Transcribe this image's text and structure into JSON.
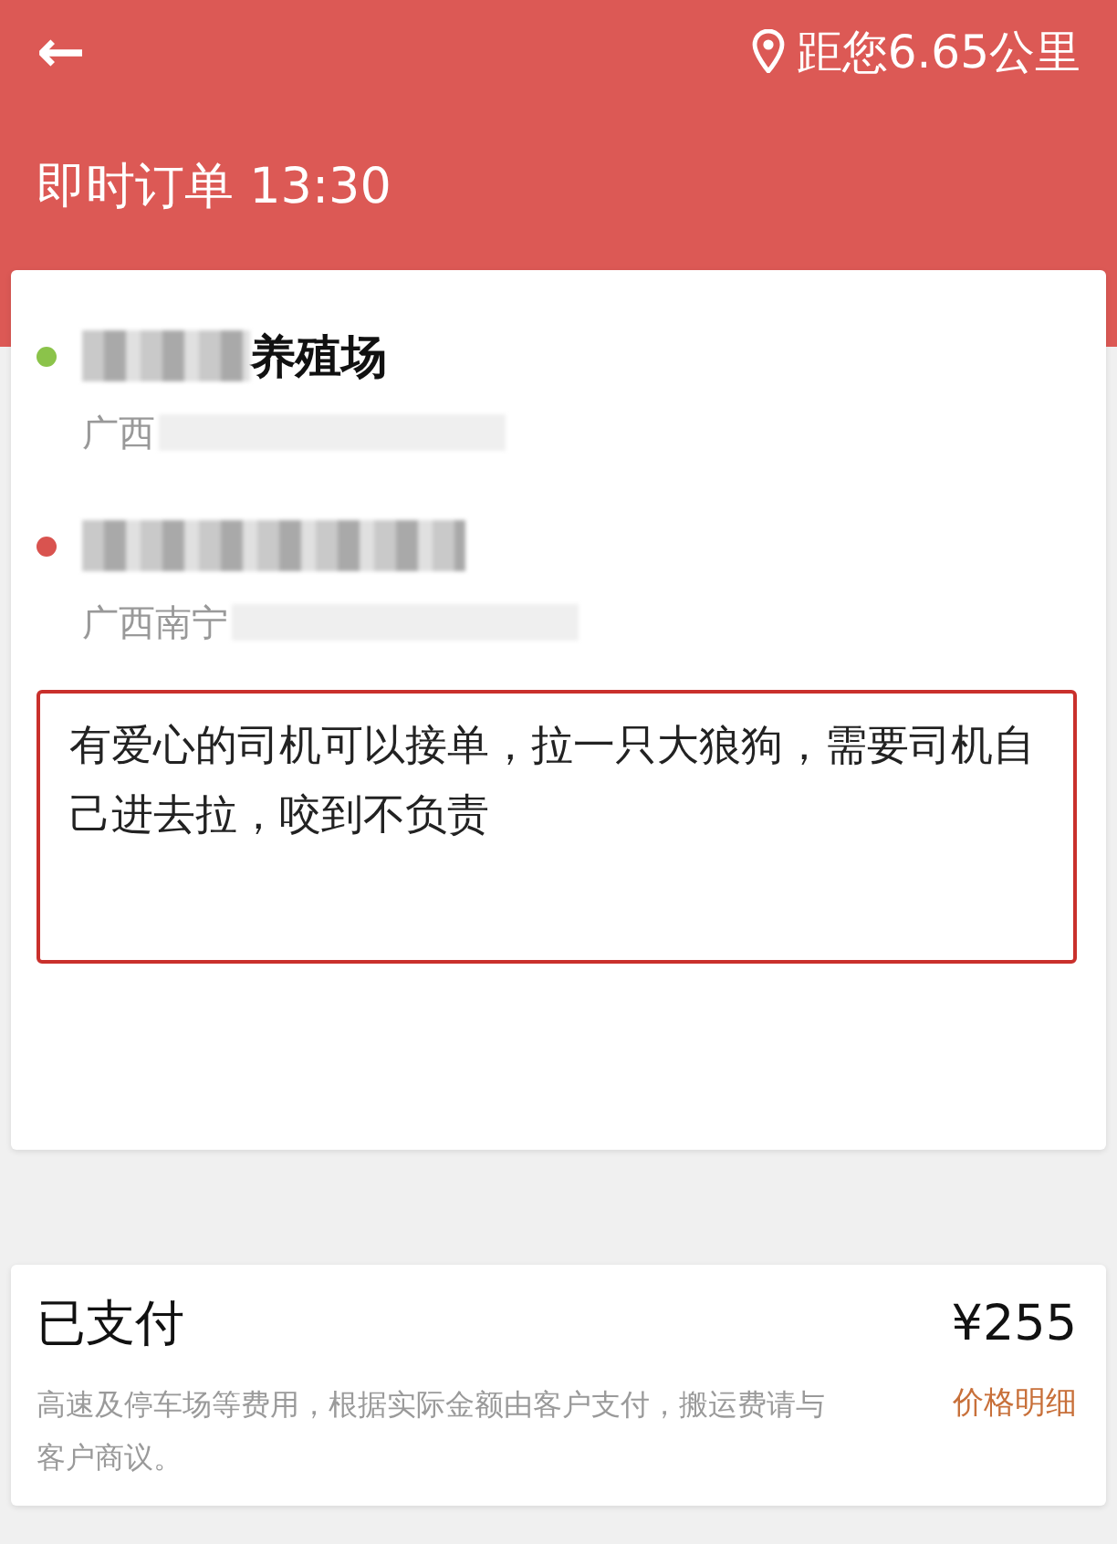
{
  "header": {
    "back": "←",
    "distance": "距您6.65公里",
    "title": "即时订单 13:30"
  },
  "stops": [
    {
      "name": "养殖场",
      "name_redacted": true,
      "address": "广西",
      "color": "#8bc34a"
    },
    {
      "name_redacted": true,
      "address": "广西南宁",
      "color": "#d9534f"
    }
  ],
  "note": "有爱心的司机可以接单，拉一只大狼狗，需要司机自己进去拉，咬到不负责",
  "payment": {
    "status": "已支付",
    "price": "¥255",
    "hint": "高速及停车场等费用，根据实际金额由客户支付，搬运费请与客户商议。",
    "link": "价格明细"
  }
}
